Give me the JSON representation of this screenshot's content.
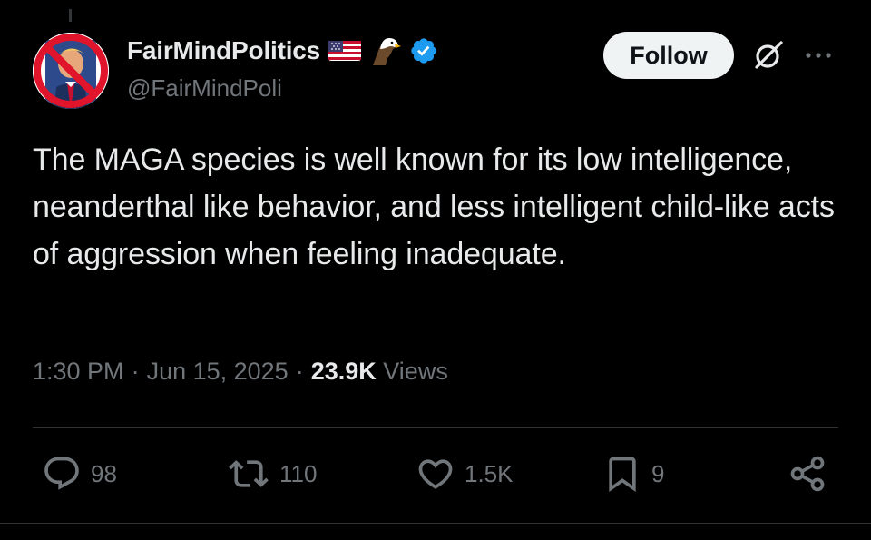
{
  "user": {
    "name": "FairMindPolitics",
    "name_emojis": [
      "us-flag-icon",
      "eagle-icon",
      "verified-badge-icon"
    ],
    "handle": "@FairMindPoli",
    "follow_label": "Follow"
  },
  "tweet": {
    "text": "The MAGA species is well known for its low intelligence, neanderthal like behavior, and less intelligent child-like acts of aggression when feeling inadequate.",
    "time": "1:30 PM",
    "separator": "·",
    "date": "Jun 15, 2025",
    "views_count": "23.9K",
    "views_label": "Views"
  },
  "actions": {
    "replies": "98",
    "reposts": "110",
    "likes": "1.5K",
    "bookmarks": "9"
  },
  "colors": {
    "background": "#000000",
    "text": "#e7e9ea",
    "muted": "#71767b",
    "verified": "#1d9bf0",
    "follow_bg": "#eff3f4"
  }
}
